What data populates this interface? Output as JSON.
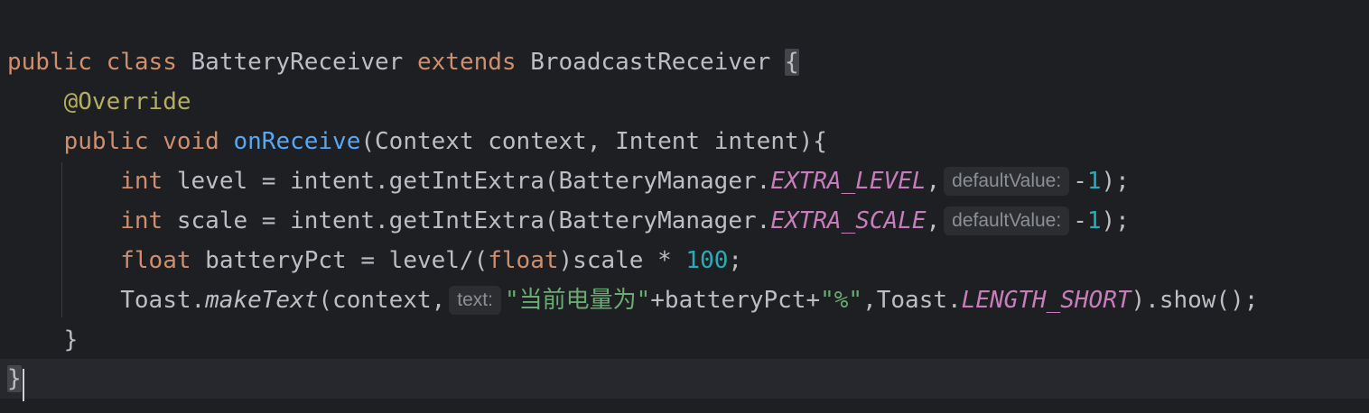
{
  "editor": {
    "theme_colors": {
      "background": "#1e1f22",
      "keyword": "#cf8e6d",
      "annotation": "#b3ae60",
      "method_declaration": "#56a8f5",
      "static_constant": "#c77dbb",
      "number": "#2aacb8",
      "string": "#6aab73",
      "default_text": "#bcbec4",
      "inlay_hint_text": "#8c8f94"
    },
    "lines": {
      "l1": {
        "kw_public": "public",
        "kw_class": "class",
        "class_name": "BatteryReceiver",
        "kw_extends": "extends",
        "super_name": "BroadcastReceiver",
        "open_brace": "{"
      },
      "l2": {
        "annotation": "@Override"
      },
      "l3": {
        "kw_public": "public",
        "kw_void": "void",
        "method": "onReceive",
        "params": "(Context context, Intent intent){"
      },
      "l4": {
        "kw_int": "int",
        "text_a": "level = intent.getIntExtra(BatteryManager.",
        "const": "EXTRA_LEVEL",
        "comma": ",",
        "hint": "defaultValue:",
        "minus": "-",
        "num": "1",
        "end": ");"
      },
      "l5": {
        "kw_int": "int",
        "text_a": "scale = intent.getIntExtra(BatteryManager.",
        "const": "EXTRA_SCALE",
        "comma": ",",
        "hint": "defaultValue:",
        "minus": "-",
        "num": "1",
        "end": ");"
      },
      "l6": {
        "kw_float": "float",
        "text_a": "batteryPct = level/(",
        "kw_float_cast": "float",
        "text_b": ")scale * ",
        "num": "100",
        "end": ";"
      },
      "l7": {
        "text_a": "Toast.",
        "static_method": "makeText",
        "text_b": "(context,",
        "hint": "text:",
        "str_a": "\"当前电量为\"",
        "text_c": "+batteryPct+",
        "str_b": "\"%\"",
        "text_d": ",Toast.",
        "const": "LENGTH_SHORT",
        "end": ").show();"
      },
      "l8": {
        "close_brace": "}"
      },
      "l9": {
        "close_brace": "}"
      }
    }
  }
}
